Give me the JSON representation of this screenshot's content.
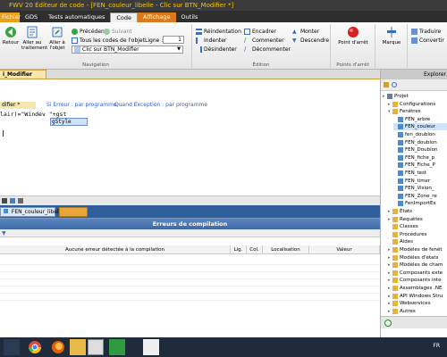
{
  "window": {
    "title": "FWV 20  Éditeur de code - [FEN_couleur_libelle - Clic sur BTN_Modifier *]"
  },
  "ribbon_tabs": [
    "Fichier",
    "GDS",
    "Tests automatiques",
    "Code",
    "Affichage",
    "Outils"
  ],
  "ribbon": {
    "retour": "Retour",
    "aller_traitement": "Aller au traitement",
    "aller_objet": "Aller à l'objet",
    "precedent": "Précédent",
    "suivant": "Suivant",
    "tous_codes": "Tous les codes de l'objet",
    "ligne_label": "Ligne :",
    "ligne_value": "1",
    "combo_value": "Clic sur BTN_Modifier",
    "nav_group": "Navigation",
    "reindentation": "Réindentation",
    "indenter": "Indenter",
    "desindenter": "Désindenter",
    "encadrer": "Encadrer",
    "commenter": "Commenter",
    "decommenter": "Décommenter",
    "monter": "Monter",
    "descendre": "Descendre",
    "edition_group": "Édition",
    "point_arret": "Point d'arrêt",
    "points_group": "Points d'arrêt",
    "marque": "Marque",
    "traduire": "Traduire",
    "convertir": "Convertir"
  },
  "code_tab": {
    "label": "i_Modifier"
  },
  "editor": {
    "proc_tab": "difier *",
    "si_erreur": "Si Erreur : par programme",
    "quand_exception": "Quand Exception : par programme",
    "code_prefix": "lair)=\"Windev \"+",
    "code_typed": "gst",
    "autocomplete": "gStyle"
  },
  "pane_tab": {
    "label": "FEN_couleur_libelle"
  },
  "errors_pane": {
    "title": "Erreurs de compilation",
    "col_message": "Aucune erreur détectée à la compilation",
    "col_lig": "Lig.",
    "col_col": "Col.",
    "col_localisation": "Localisation",
    "col_valeur": "Valeur"
  },
  "explorer": {
    "title": "Explorer",
    "items": [
      {
        "label": "Projet",
        "level": 0,
        "exp": "▸",
        "color": "#6b7d96",
        "selected": false
      },
      {
        "label": "Configurations",
        "level": 1,
        "exp": "▸",
        "color": "#e3b343",
        "selected": false
      },
      {
        "label": "Fenêtres",
        "level": 1,
        "exp": "▾",
        "color": "#e3b343",
        "selected": false
      },
      {
        "label": "FEN_arbre",
        "level": 2,
        "exp": "",
        "color": "#4d8ad6",
        "selected": false
      },
      {
        "label": "FEN_couleur",
        "level": 2,
        "exp": "",
        "color": "#4d8ad6",
        "selected": true
      },
      {
        "label": "fen_doublon",
        "level": 2,
        "exp": "",
        "color": "#4d8ad6",
        "selected": false
      },
      {
        "label": "FEN_doublon",
        "level": 2,
        "exp": "",
        "color": "#4d8ad6",
        "selected": false
      },
      {
        "label": "FEN_Doublon",
        "level": 2,
        "exp": "",
        "color": "#4d8ad6",
        "selected": false
      },
      {
        "label": "FEN_fiche_p",
        "level": 2,
        "exp": "",
        "color": "#4d8ad6",
        "selected": false
      },
      {
        "label": "FEN_Fiche_P",
        "level": 2,
        "exp": "",
        "color": "#4d8ad6",
        "selected": false
      },
      {
        "label": "FEN_test",
        "level": 2,
        "exp": "",
        "color": "#4d8ad6",
        "selected": false
      },
      {
        "label": "FEN_timer",
        "level": 2,
        "exp": "",
        "color": "#4d8ad6",
        "selected": false
      },
      {
        "label": "FEN_Vision_",
        "level": 2,
        "exp": "",
        "color": "#4d8ad6",
        "selected": false
      },
      {
        "label": "FEN_Zone_re",
        "level": 2,
        "exp": "",
        "color": "#4d8ad6",
        "selected": false
      },
      {
        "label": "FenImportEx",
        "level": 2,
        "exp": "",
        "color": "#4d8ad6",
        "selected": false
      },
      {
        "label": "États",
        "level": 1,
        "exp": "▸",
        "color": "#e3b343",
        "selected": false
      },
      {
        "label": "Requêtes",
        "level": 1,
        "exp": "▸",
        "color": "#e3b343",
        "selected": false
      },
      {
        "label": "Classes",
        "level": 1,
        "exp": "",
        "color": "#e3b343",
        "selected": false
      },
      {
        "label": "Procédures",
        "level": 1,
        "exp": "",
        "color": "#e3b343",
        "selected": false
      },
      {
        "label": "Aides",
        "level": 1,
        "exp": "",
        "color": "#e3b343",
        "selected": false
      },
      {
        "label": "Modèles de fenêt",
        "level": 1,
        "exp": "▸",
        "color": "#e3b343",
        "selected": false
      },
      {
        "label": "Modèles d'états",
        "level": 1,
        "exp": "▸",
        "color": "#e3b343",
        "selected": false
      },
      {
        "label": "Modèles de cham",
        "level": 1,
        "exp": "▸",
        "color": "#e3b343",
        "selected": false
      },
      {
        "label": "Composants exte",
        "level": 1,
        "exp": "▸",
        "color": "#e3b343",
        "selected": false
      },
      {
        "label": "Composants inte",
        "level": 1,
        "exp": "▸",
        "color": "#e3b343",
        "selected": false
      },
      {
        "label": "Assemblages .NE",
        "level": 1,
        "exp": "▸",
        "color": "#e3b343",
        "selected": false
      },
      {
        "label": "API Windows Stru",
        "level": 1,
        "exp": "▸",
        "color": "#e3b343",
        "selected": false
      },
      {
        "label": "Webservices",
        "level": 1,
        "exp": "▸",
        "color": "#e3b343",
        "selected": false
      },
      {
        "label": "Autres",
        "level": 1,
        "exp": "▸",
        "color": "#e3b343",
        "selected": false
      }
    ]
  },
  "taskbar": {
    "lang": "FR"
  }
}
